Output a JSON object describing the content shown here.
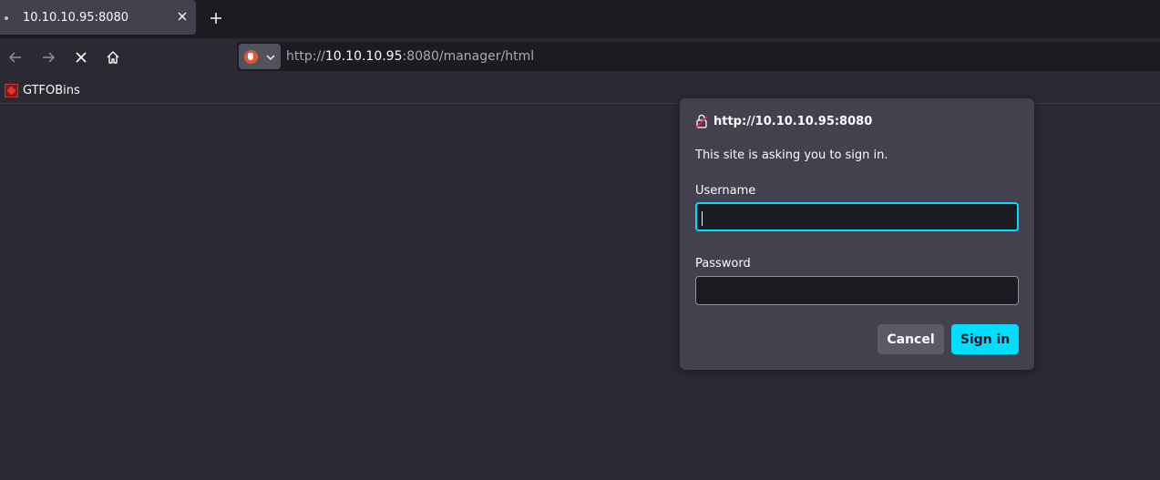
{
  "tab": {
    "title": "10.10.10.95:8080"
  },
  "urlbar": {
    "scheme": "http://",
    "host": "10.10.10.95",
    "rest": ":8080/manager/html"
  },
  "bookmarks": [
    {
      "label": "GTFOBins"
    }
  ],
  "dialog": {
    "origin": "http://10.10.10.95:8080",
    "message": "This site is asking you to sign in.",
    "username_label": "Username",
    "username_value": "",
    "password_label": "Password",
    "password_value": "",
    "cancel_label": "Cancel",
    "signin_label": "Sign in"
  },
  "colors": {
    "accent": "#00ddff",
    "chrome_dark": "#1c1b22",
    "chrome": "#2b2a33",
    "dialog_bg": "#42414d"
  },
  "icons": [
    "tab-close-icon",
    "plus-icon",
    "back-arrow-icon",
    "forward-arrow-icon",
    "stop-icon",
    "home-icon",
    "duckduckgo-icon",
    "chevron-down-icon",
    "bookmark-favicon",
    "insecure-lock-icon"
  ]
}
